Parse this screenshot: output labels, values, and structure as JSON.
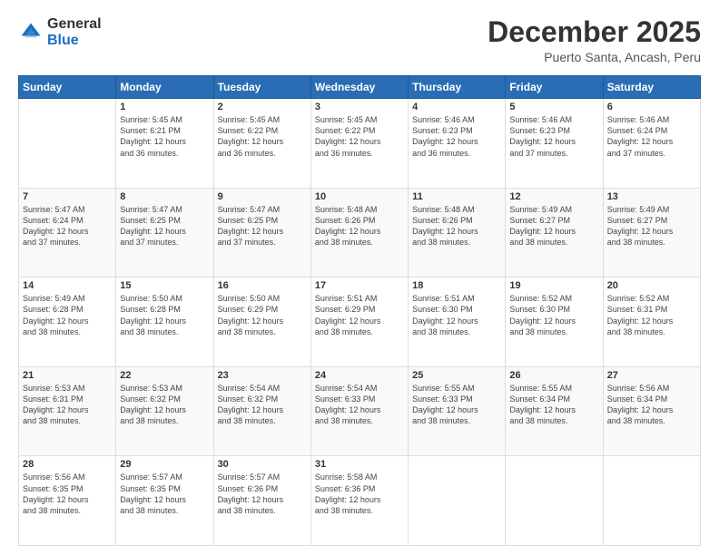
{
  "header": {
    "logo_general": "General",
    "logo_blue": "Blue",
    "month_title": "December 2025",
    "subtitle": "Puerto Santa, Ancash, Peru"
  },
  "days_of_week": [
    "Sunday",
    "Monday",
    "Tuesday",
    "Wednesday",
    "Thursday",
    "Friday",
    "Saturday"
  ],
  "weeks": [
    [
      {
        "day": "",
        "content": ""
      },
      {
        "day": "1",
        "content": "Sunrise: 5:45 AM\nSunset: 6:21 PM\nDaylight: 12 hours\nand 36 minutes."
      },
      {
        "day": "2",
        "content": "Sunrise: 5:45 AM\nSunset: 6:22 PM\nDaylight: 12 hours\nand 36 minutes."
      },
      {
        "day": "3",
        "content": "Sunrise: 5:45 AM\nSunset: 6:22 PM\nDaylight: 12 hours\nand 36 minutes."
      },
      {
        "day": "4",
        "content": "Sunrise: 5:46 AM\nSunset: 6:23 PM\nDaylight: 12 hours\nand 36 minutes."
      },
      {
        "day": "5",
        "content": "Sunrise: 5:46 AM\nSunset: 6:23 PM\nDaylight: 12 hours\nand 37 minutes."
      },
      {
        "day": "6",
        "content": "Sunrise: 5:46 AM\nSunset: 6:24 PM\nDaylight: 12 hours\nand 37 minutes."
      }
    ],
    [
      {
        "day": "7",
        "content": "Sunrise: 5:47 AM\nSunset: 6:24 PM\nDaylight: 12 hours\nand 37 minutes."
      },
      {
        "day": "8",
        "content": "Sunrise: 5:47 AM\nSunset: 6:25 PM\nDaylight: 12 hours\nand 37 minutes."
      },
      {
        "day": "9",
        "content": "Sunrise: 5:47 AM\nSunset: 6:25 PM\nDaylight: 12 hours\nand 37 minutes."
      },
      {
        "day": "10",
        "content": "Sunrise: 5:48 AM\nSunset: 6:26 PM\nDaylight: 12 hours\nand 38 minutes."
      },
      {
        "day": "11",
        "content": "Sunrise: 5:48 AM\nSunset: 6:26 PM\nDaylight: 12 hours\nand 38 minutes."
      },
      {
        "day": "12",
        "content": "Sunrise: 5:49 AM\nSunset: 6:27 PM\nDaylight: 12 hours\nand 38 minutes."
      },
      {
        "day": "13",
        "content": "Sunrise: 5:49 AM\nSunset: 6:27 PM\nDaylight: 12 hours\nand 38 minutes."
      }
    ],
    [
      {
        "day": "14",
        "content": "Sunrise: 5:49 AM\nSunset: 6:28 PM\nDaylight: 12 hours\nand 38 minutes."
      },
      {
        "day": "15",
        "content": "Sunrise: 5:50 AM\nSunset: 6:28 PM\nDaylight: 12 hours\nand 38 minutes."
      },
      {
        "day": "16",
        "content": "Sunrise: 5:50 AM\nSunset: 6:29 PM\nDaylight: 12 hours\nand 38 minutes."
      },
      {
        "day": "17",
        "content": "Sunrise: 5:51 AM\nSunset: 6:29 PM\nDaylight: 12 hours\nand 38 minutes."
      },
      {
        "day": "18",
        "content": "Sunrise: 5:51 AM\nSunset: 6:30 PM\nDaylight: 12 hours\nand 38 minutes."
      },
      {
        "day": "19",
        "content": "Sunrise: 5:52 AM\nSunset: 6:30 PM\nDaylight: 12 hours\nand 38 minutes."
      },
      {
        "day": "20",
        "content": "Sunrise: 5:52 AM\nSunset: 6:31 PM\nDaylight: 12 hours\nand 38 minutes."
      }
    ],
    [
      {
        "day": "21",
        "content": "Sunrise: 5:53 AM\nSunset: 6:31 PM\nDaylight: 12 hours\nand 38 minutes."
      },
      {
        "day": "22",
        "content": "Sunrise: 5:53 AM\nSunset: 6:32 PM\nDaylight: 12 hours\nand 38 minutes."
      },
      {
        "day": "23",
        "content": "Sunrise: 5:54 AM\nSunset: 6:32 PM\nDaylight: 12 hours\nand 38 minutes."
      },
      {
        "day": "24",
        "content": "Sunrise: 5:54 AM\nSunset: 6:33 PM\nDaylight: 12 hours\nand 38 minutes."
      },
      {
        "day": "25",
        "content": "Sunrise: 5:55 AM\nSunset: 6:33 PM\nDaylight: 12 hours\nand 38 minutes."
      },
      {
        "day": "26",
        "content": "Sunrise: 5:55 AM\nSunset: 6:34 PM\nDaylight: 12 hours\nand 38 minutes."
      },
      {
        "day": "27",
        "content": "Sunrise: 5:56 AM\nSunset: 6:34 PM\nDaylight: 12 hours\nand 38 minutes."
      }
    ],
    [
      {
        "day": "28",
        "content": "Sunrise: 5:56 AM\nSunset: 6:35 PM\nDaylight: 12 hours\nand 38 minutes."
      },
      {
        "day": "29",
        "content": "Sunrise: 5:57 AM\nSunset: 6:35 PM\nDaylight: 12 hours\nand 38 minutes."
      },
      {
        "day": "30",
        "content": "Sunrise: 5:57 AM\nSunset: 6:36 PM\nDaylight: 12 hours\nand 38 minutes."
      },
      {
        "day": "31",
        "content": "Sunrise: 5:58 AM\nSunset: 6:36 PM\nDaylight: 12 hours\nand 38 minutes."
      },
      {
        "day": "",
        "content": ""
      },
      {
        "day": "",
        "content": ""
      },
      {
        "day": "",
        "content": ""
      }
    ]
  ]
}
